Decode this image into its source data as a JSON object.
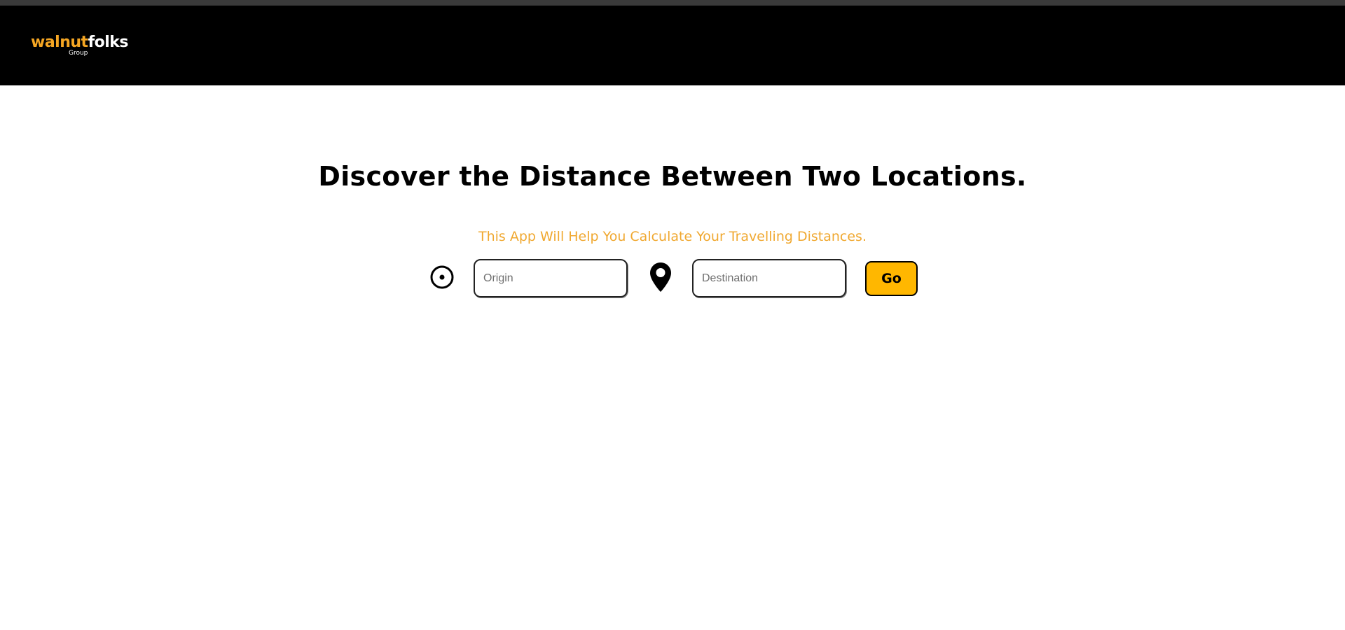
{
  "header": {
    "logo": {
      "part1": "walnut",
      "part2": "folks",
      "sub": "Group"
    }
  },
  "main": {
    "title": "Discover the Distance Between Two Locations.",
    "subtitle": "This App Will Help You Calculate Your Travelling Distances."
  },
  "form": {
    "origin_placeholder": "Origin",
    "origin_value": "",
    "destination_placeholder": "Destination",
    "destination_value": "",
    "go_label": "Go",
    "origin_icon": "target-circle-icon",
    "destination_icon": "map-pin-icon"
  },
  "colors": {
    "header_bg": "#000000",
    "accent": "#f5a623",
    "button_bg": "#ffb700",
    "subtitle": "#f0a830"
  }
}
